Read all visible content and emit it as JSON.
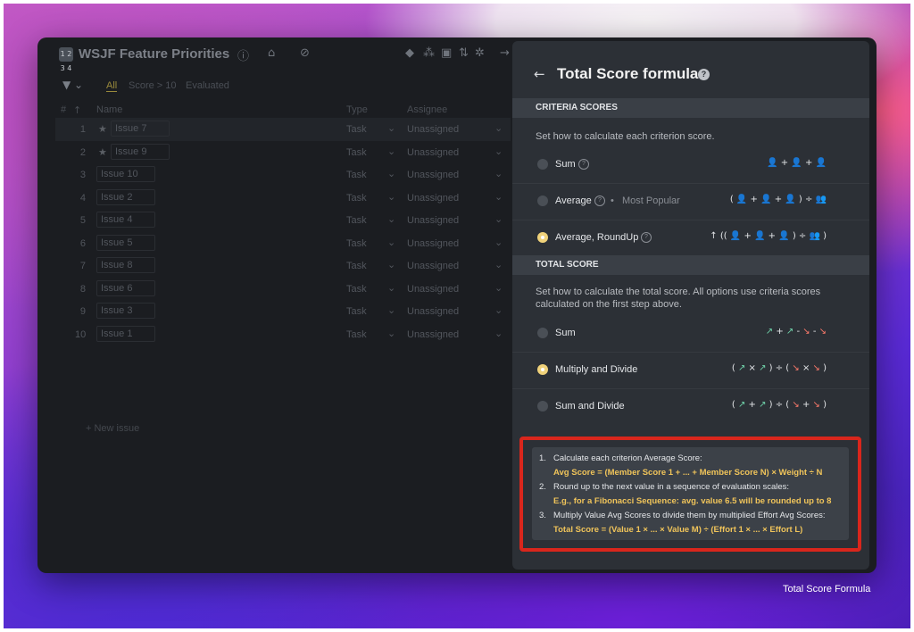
{
  "app": {
    "title": "WSJF Feature Priorities",
    "icon_text": "1 2 3 4",
    "toolbar_icons": [
      "info-icon",
      "unlock-icon",
      "bell-off-icon",
      "card-icon",
      "cluster-icon",
      "board-icon",
      "sort-icon",
      "settings-icon",
      "arrow-right-icon"
    ]
  },
  "filters": {
    "tabs": [
      "All",
      "Score > 10",
      "Evaluated"
    ]
  },
  "table": {
    "headers": {
      "index": "#",
      "name": "Name",
      "type": "Type",
      "assignee": "Assignee"
    },
    "rows": [
      {
        "num": "1",
        "name": "Issue 7",
        "starred": true,
        "type": "Task",
        "assignee": "Unassigned"
      },
      {
        "num": "2",
        "name": "Issue 9",
        "starred": true,
        "type": "Task",
        "assignee": "Unassigned"
      },
      {
        "num": "3",
        "name": "Issue 10",
        "starred": false,
        "type": "Task",
        "assignee": "Unassigned"
      },
      {
        "num": "4",
        "name": "Issue 2",
        "starred": false,
        "type": "Task",
        "assignee": "Unassigned"
      },
      {
        "num": "5",
        "name": "Issue 4",
        "starred": false,
        "type": "Task",
        "assignee": "Unassigned"
      },
      {
        "num": "6",
        "name": "Issue 5",
        "starred": false,
        "type": "Task",
        "assignee": "Unassigned"
      },
      {
        "num": "7",
        "name": "Issue 8",
        "starred": false,
        "type": "Task",
        "assignee": "Unassigned"
      },
      {
        "num": "8",
        "name": "Issue 6",
        "starred": false,
        "type": "Task",
        "assignee": "Unassigned"
      },
      {
        "num": "9",
        "name": "Issue 3",
        "starred": false,
        "type": "Task",
        "assignee": "Unassigned"
      },
      {
        "num": "10",
        "name": "Issue 1",
        "starred": false,
        "type": "Task",
        "assignee": "Unassigned"
      }
    ],
    "new_issue": "+ New issue"
  },
  "panel": {
    "title": "Total Score formula",
    "criteria": {
      "heading": "CRITERIA SCORES",
      "description": "Set how to calculate each criterion score.",
      "options": [
        {
          "label": "Sum",
          "selected": false,
          "formula": "👤 + 👤 + 👤"
        },
        {
          "label": "Average",
          "selected": false,
          "tag": "Most Popular",
          "formula": "( 👤 + 👤 + 👤 ) ÷ 👥"
        },
        {
          "label": "Average, RoundUp",
          "selected": true,
          "formula": "↑ (( 👤 + 👤 + 👤 ) ÷ 👥 )"
        }
      ]
    },
    "total": {
      "heading": "TOTAL SCORE",
      "description": "Set how to calculate the total score. All options use criteria scores calculated on the first step above.",
      "options": [
        {
          "label": "Sum",
          "selected": false
        },
        {
          "label": "Multiply and Divide",
          "selected": true
        },
        {
          "label": "Sum and Divide",
          "selected": false
        }
      ]
    },
    "steps": [
      {
        "n": "1.",
        "text": "Calculate each criterion Average Score:",
        "formula": "Avg Score = (Member Score 1 + ... + Member Score N) × Weight ÷ N"
      },
      {
        "n": "2.",
        "text": "Round up to the next value in a sequence of evaluation scales:",
        "formula": "E.g., for a Fibonacci Sequence: avg. value 6.5 will be rounded up to 8"
      },
      {
        "n": "3.",
        "text": "Multiply Value Avg Scores to divide them by multiplied Effort Avg Scores:",
        "formula": "Total Score = (Value 1 × ... × Value M) ÷ (Effort 1 × ... × Effort L)"
      }
    ]
  },
  "caption": "Total Score Formula",
  "colors": {
    "highlight_border": "#d9261c",
    "formula_text": "#f0c45a",
    "selected_radio": "#f0d27a",
    "value_arrow": "#6fd0a8",
    "effort_arrow": "#ff7b6b"
  }
}
